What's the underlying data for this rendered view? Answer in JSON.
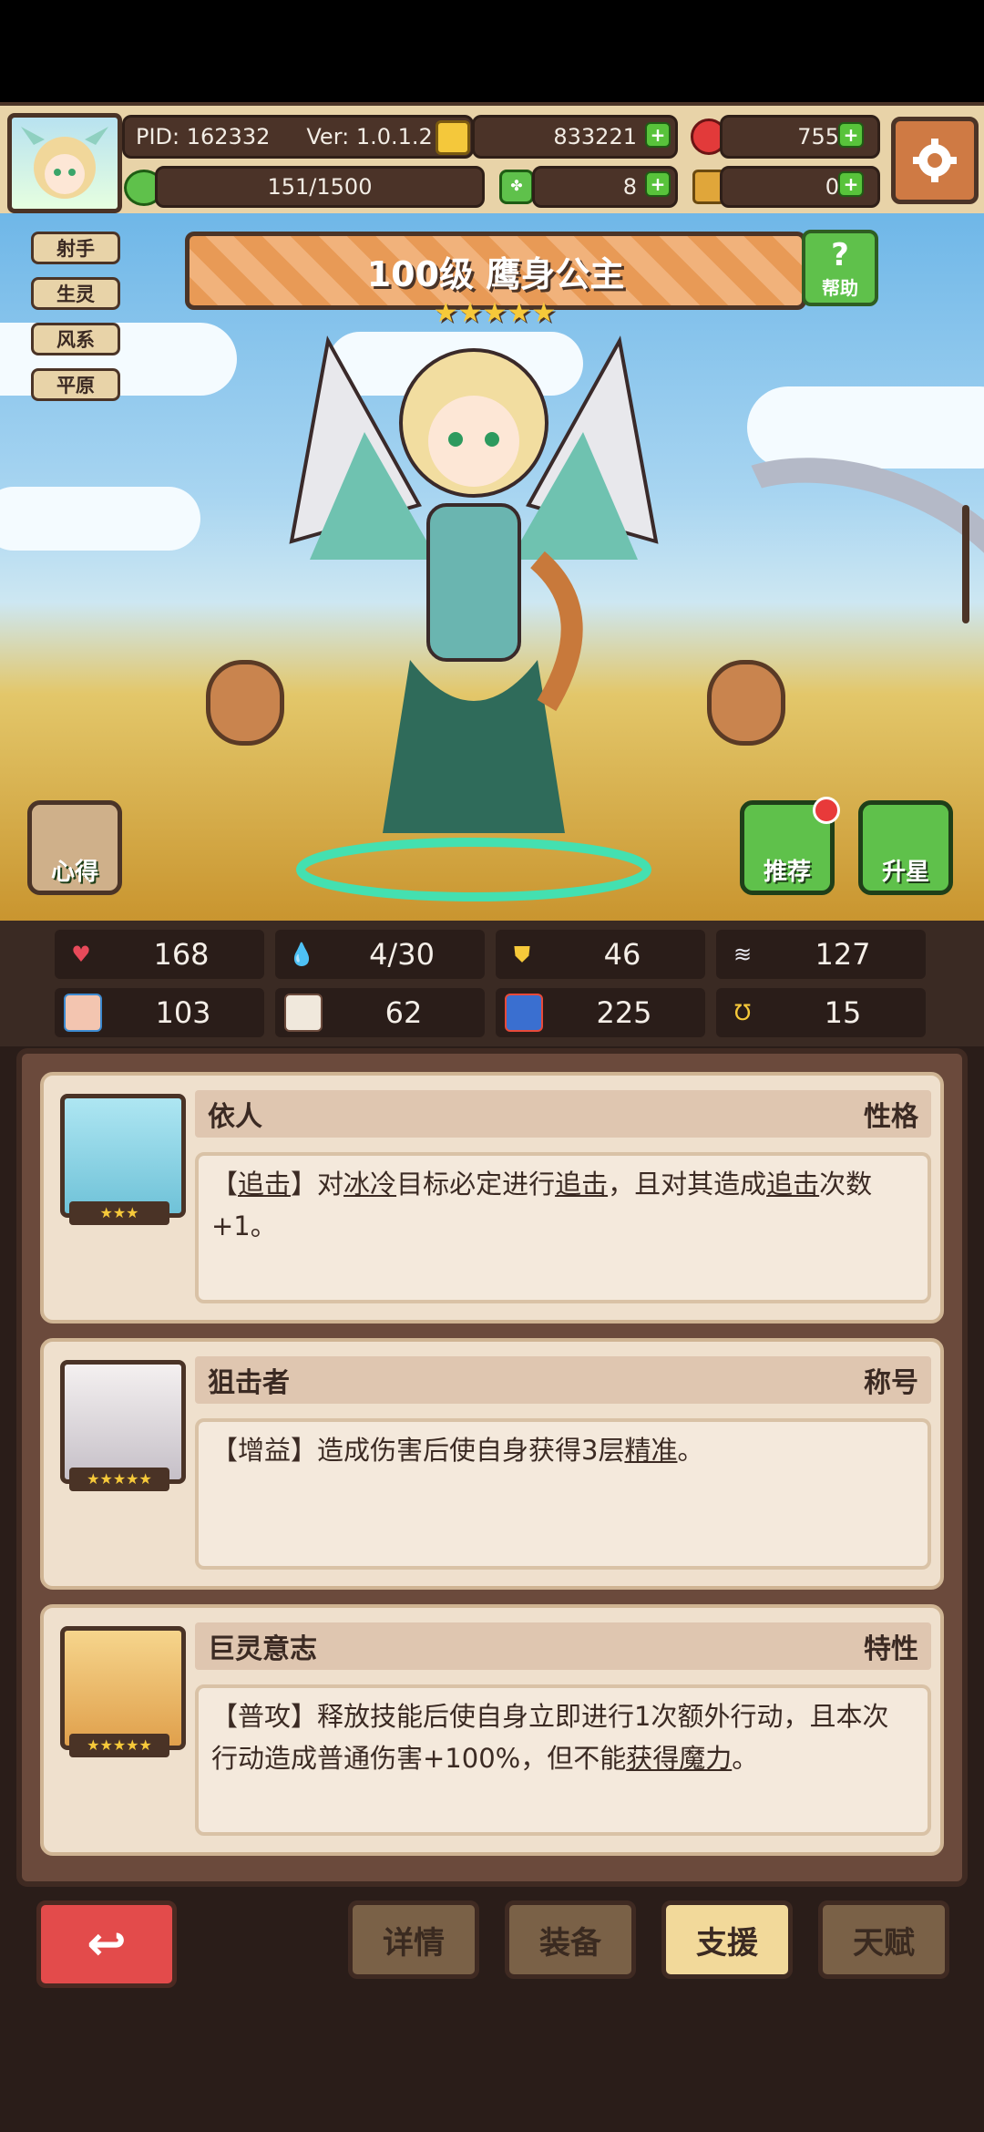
{
  "hud": {
    "pid": "PID: 162332",
    "version": "Ver: 1.0.1.2",
    "gold": "833221",
    "gems": "755",
    "stamina": "151/1500",
    "clover": "8",
    "key": "0"
  },
  "tags": [
    "射手",
    "生灵",
    "风系",
    "平原"
  ],
  "hero": {
    "name": "100级 鹰身公主",
    "stars": "★★★★★",
    "help_label": "帮助"
  },
  "buttons": {
    "insight": "心得",
    "recommend": "推荐",
    "star_up": "升星"
  },
  "stats": [
    {
      "icon": "heart-icon",
      "value": "168"
    },
    {
      "icon": "droplet-icon",
      "value": "4/30"
    },
    {
      "icon": "shield-icon",
      "value": "46"
    },
    {
      "icon": "wing-icon",
      "value": "127"
    },
    {
      "icon": "fist-icon",
      "value": "103"
    },
    {
      "icon": "book-icon",
      "value": "62"
    },
    {
      "icon": "speed-icon",
      "value": "225"
    },
    {
      "icon": "horseshoe-icon",
      "value": "15"
    }
  ],
  "cards": [
    {
      "name": "依人",
      "type": "性格",
      "stars": "★★★",
      "desc_parts": [
        "【",
        "追击",
        "】对",
        "冰冷",
        "目标必定进行",
        "追击",
        "，且对其造成",
        "追击",
        "次数+1。"
      ]
    },
    {
      "name": "狙击者",
      "type": "称号",
      "stars": "★★★★★",
      "desc_parts": [
        "【增益】造成伤害后使自身获得3层",
        "精准",
        "。"
      ]
    },
    {
      "name": "巨灵意志",
      "type": "特性",
      "stars": "★★★★★",
      "desc_parts": [
        "【普攻】释放技能后使自身立即进行1次额外行动，且本次行动造成普通伤害+100%，但不能",
        "获得魔力",
        "。"
      ]
    }
  ],
  "tabs": {
    "back": "↩",
    "details": "详情",
    "equipment": "装备",
    "support": "支援",
    "talent": "天赋"
  }
}
